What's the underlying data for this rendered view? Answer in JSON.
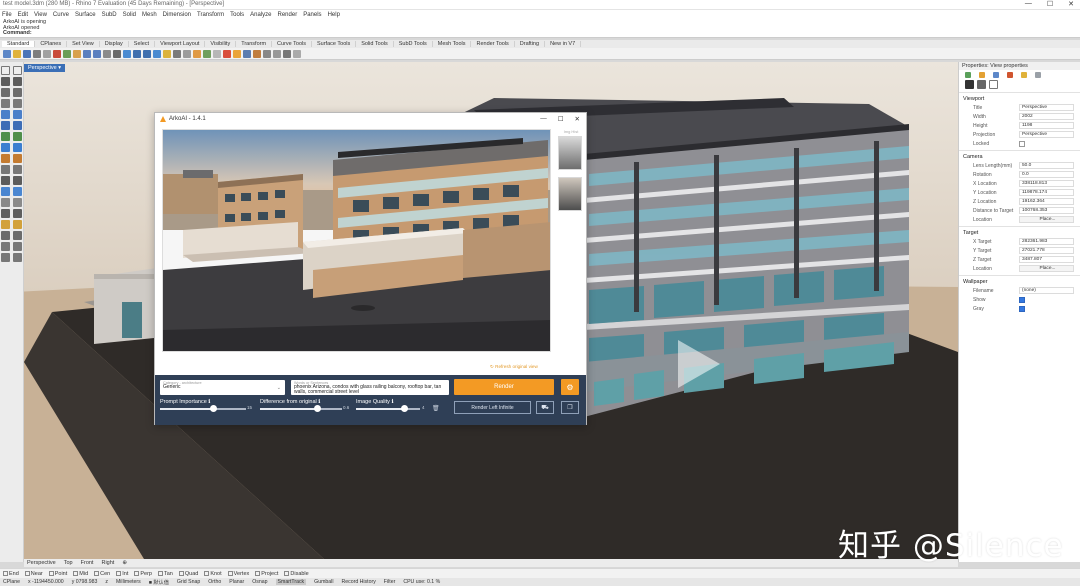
{
  "app": {
    "title": "test model.3dm (280 MB) - Rhino 7 Evaluation (45 Days Remaining) - [Perspective]",
    "window_controls": [
      "—",
      "☐",
      "✕"
    ]
  },
  "menu": [
    "File",
    "Edit",
    "View",
    "Curve",
    "Surface",
    "SubD",
    "Solid",
    "Mesh",
    "Dimension",
    "Transform",
    "Tools",
    "Analyze",
    "Render",
    "Panels",
    "Help"
  ],
  "command_history": [
    "ArkoAI is opening",
    "ArkoAI opened",
    "Command:"
  ],
  "toolbar_tabs": [
    "Standard",
    "CPlanes",
    "Set View",
    "Display",
    "Select",
    "Viewport Layout",
    "Visibility",
    "Transform",
    "Curve Tools",
    "Surface Tools",
    "Solid Tools",
    "SubD Tools",
    "Mesh Tools",
    "Render Tools",
    "Drafting",
    "New in V7"
  ],
  "viewport": {
    "active_tab": "Perspective ▾",
    "bottom_tabs": [
      "Perspective",
      "Top",
      "Front",
      "Right",
      "⊕"
    ]
  },
  "dialog": {
    "title": "ArkoAI - 1.4.1",
    "window_controls": [
      "—",
      "☐",
      "✕"
    ],
    "thumbs_label": "Img Hist",
    "refresh_link": "↻ Refresh original view",
    "category_label": "Category - architecture",
    "category_value": "Generic",
    "prompt_label": "Words or Sentences",
    "prompt_value": "phoenix Arizona, condos with glass railing balcony, rooftop bar, tan walls, commercial street level",
    "render_label": "Render",
    "render_infinite_label": "Render Left Infinite",
    "sliders": [
      {
        "label": "Prompt Importance ℹ",
        "min": "0",
        "max": "15",
        "value": 0.62
      },
      {
        "label": "Difference from original ℹ",
        "min": "0",
        "max": "0.6",
        "value": 0.7
      },
      {
        "label": "Image Quality ℹ",
        "min": "0",
        "max": "4",
        "value": 0.75
      }
    ]
  },
  "properties": {
    "header": "Properties: View properties",
    "sections": [
      {
        "title": "Viewport",
        "rows": [
          {
            "key": "Title",
            "value": "Perspective"
          },
          {
            "key": "Width",
            "value": "2002"
          },
          {
            "key": "Height",
            "value": "1198"
          },
          {
            "key": "Projection",
            "value": "Perspective"
          },
          {
            "key": "Locked",
            "value": ""
          }
        ]
      },
      {
        "title": "Camera",
        "rows": [
          {
            "key": "Lens Length(mm)",
            "value": "50.0"
          },
          {
            "key": "Rotation",
            "value": "0.0"
          },
          {
            "key": "X Location",
            "value": "338118.813"
          },
          {
            "key": "Y Location",
            "value": "119878.174"
          },
          {
            "key": "Z Location",
            "value": "19162.364"
          },
          {
            "key": "Distance to Target",
            "value": "100768.353"
          },
          {
            "key": "Location",
            "value": "Place..."
          }
        ]
      },
      {
        "title": "Target",
        "rows": [
          {
            "key": "X Target",
            "value": "282361.983"
          },
          {
            "key": "Y Target",
            "value": "27021.778"
          },
          {
            "key": "Z Target",
            "value": "3487.807"
          },
          {
            "key": "Location",
            "value": "Place..."
          }
        ]
      },
      {
        "title": "Wallpaper",
        "rows": [
          {
            "key": "Filename",
            "value": "(none)"
          },
          {
            "key": "Show",
            "value": ""
          },
          {
            "key": "Gray",
            "value": ""
          }
        ]
      }
    ]
  },
  "osnap": [
    "End",
    "Near",
    "Point",
    "Mid",
    "Cen",
    "Int",
    "Perp",
    "Tan",
    "Quad",
    "Knot",
    "Vertex",
    "Project",
    "Disable"
  ],
  "status": {
    "cplane": "CPlane",
    "x": "x -1194450.000",
    "y": "y 0798.983",
    "z": "z",
    "units": "Millimeters",
    "layer": "■ 默认值",
    "modes": [
      "Grid Snap",
      "Ortho",
      "Planar",
      "Osnap",
      "SmartTrack",
      "Gumball",
      "Record History",
      "Filter",
      "CPU use: 0.1 %"
    ]
  },
  "watermark": "知乎 @Silence",
  "colors": {
    "accent_orange": "#f39a24",
    "panel_navy": "#2f3f56",
    "viewport_tab_blue": "#3b6fb6"
  }
}
